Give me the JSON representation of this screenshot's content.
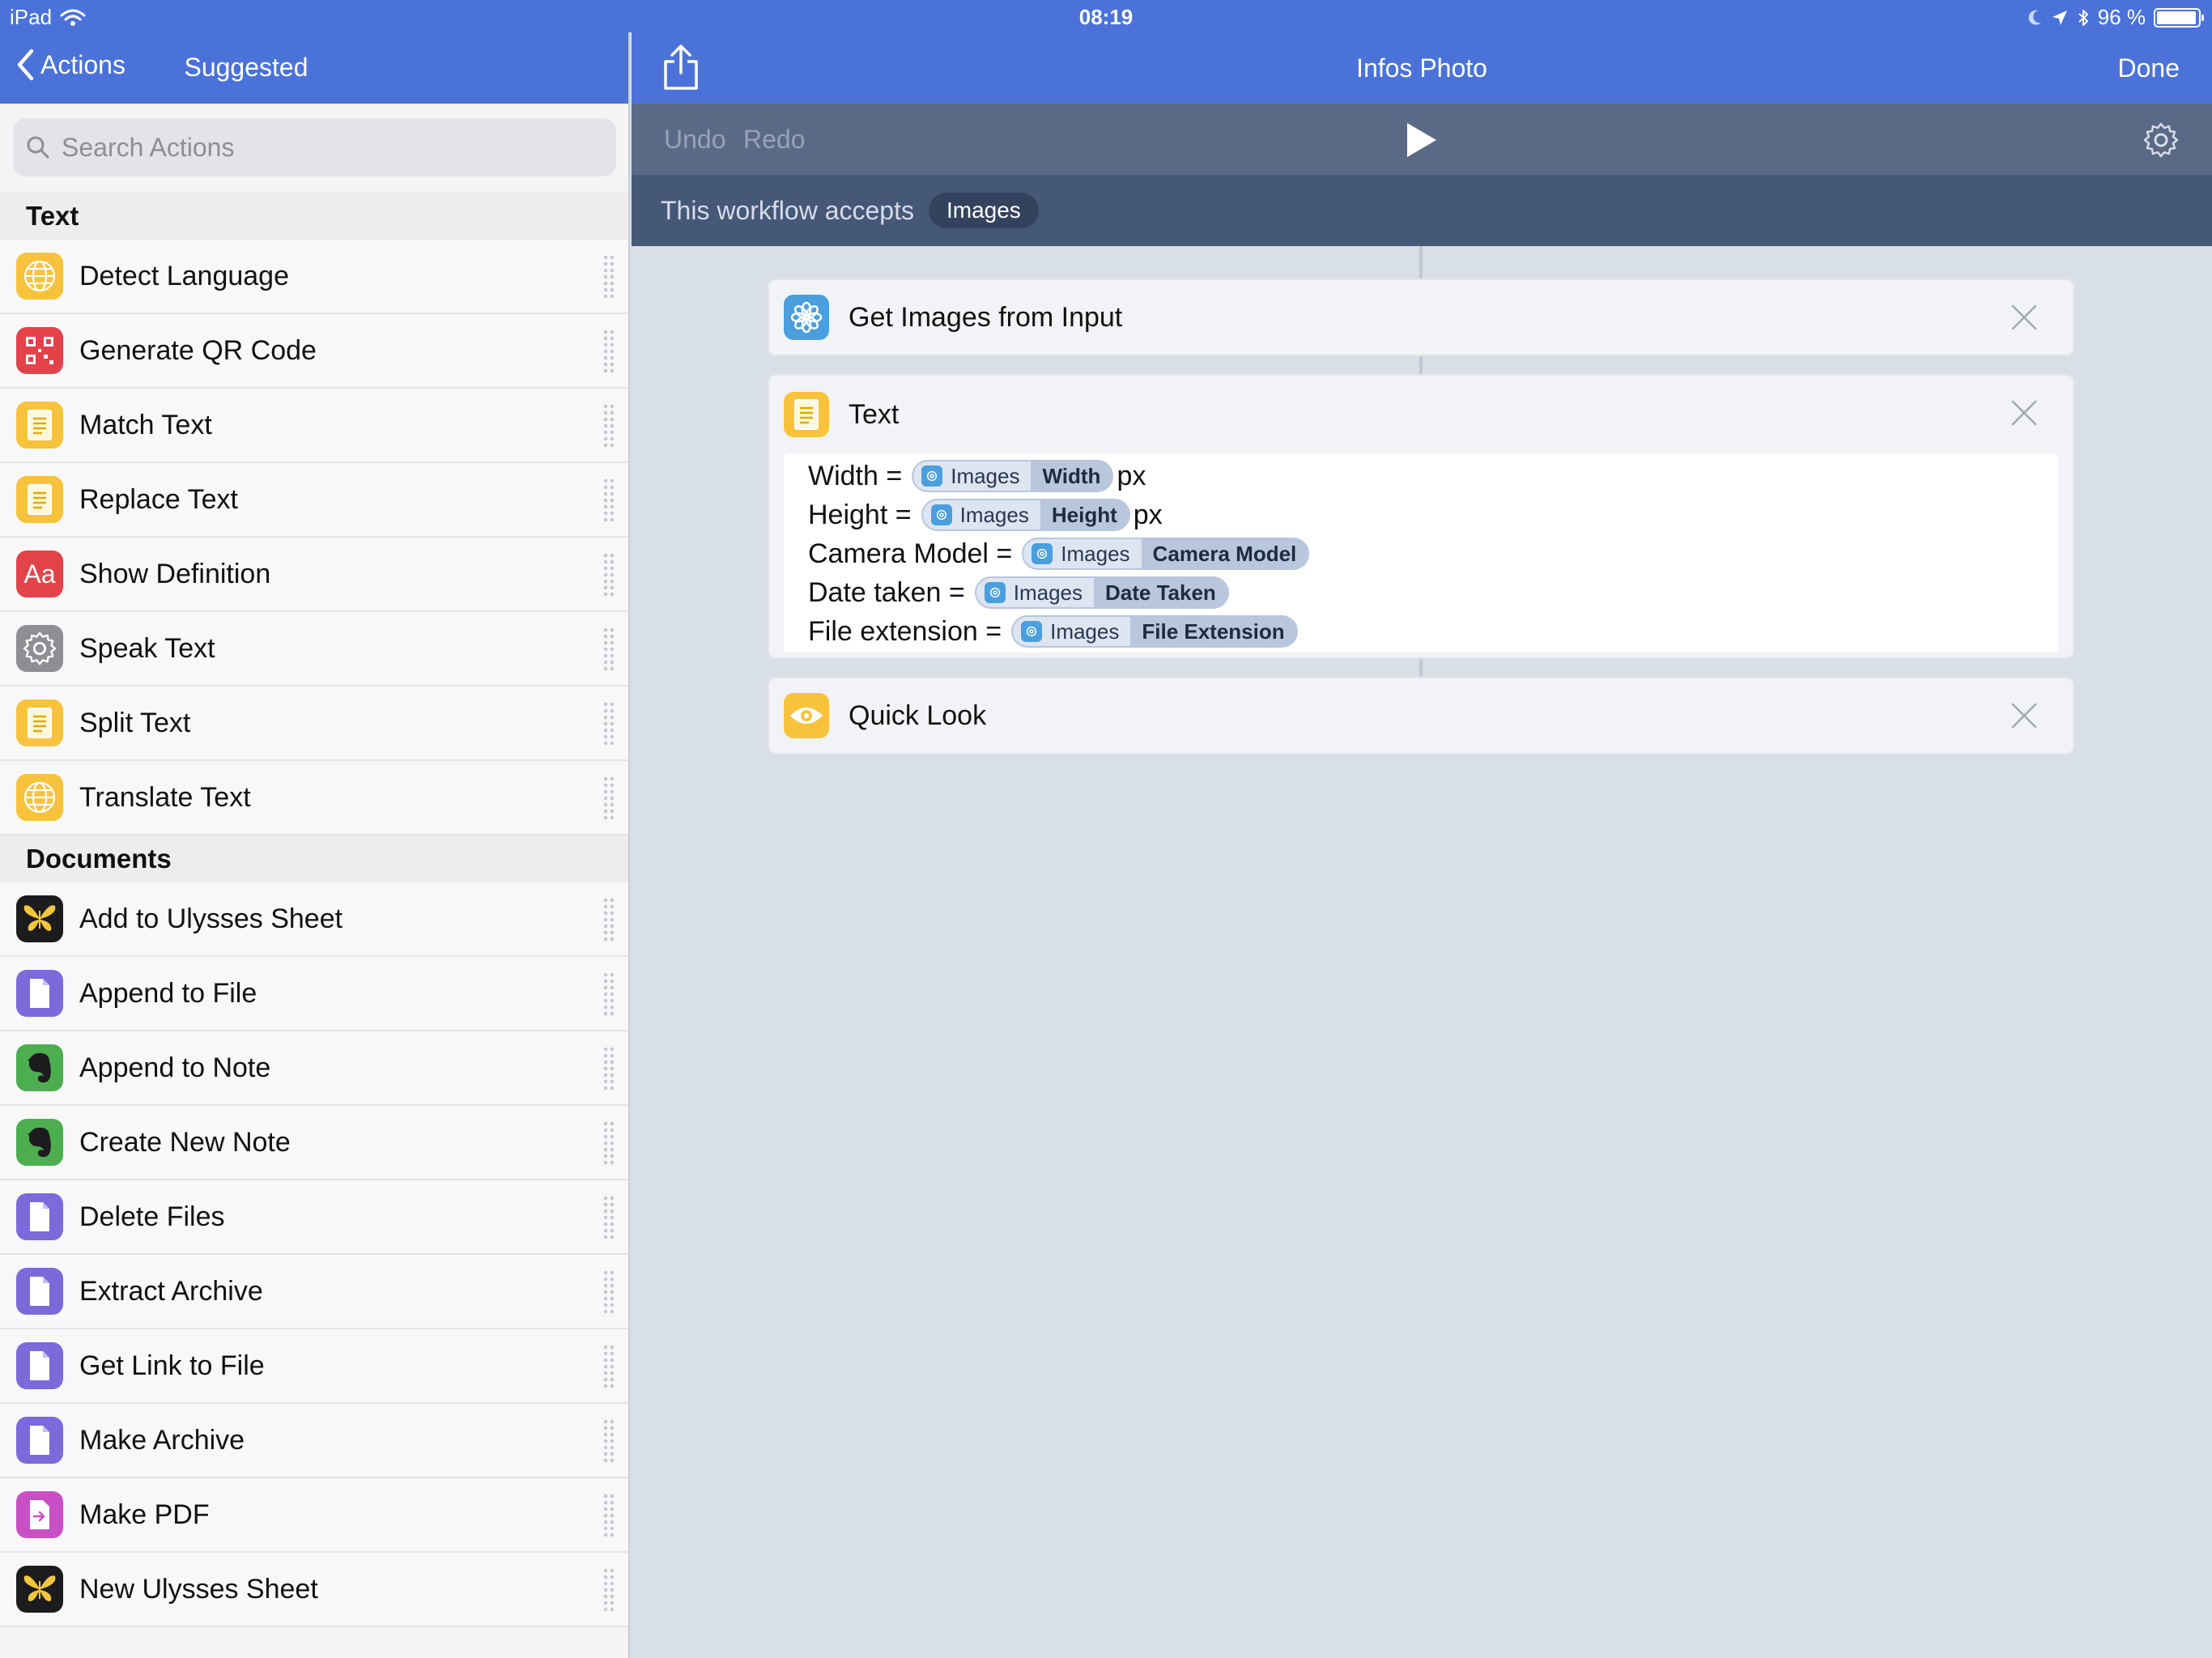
{
  "status": {
    "device": "iPad",
    "time": "08:19",
    "battery_text": "96 %",
    "battery_level": 0.96
  },
  "sidebar": {
    "back_label": "Actions",
    "title": "Suggested",
    "search_placeholder": "Search Actions",
    "sections": [
      {
        "title": "Text",
        "items": [
          {
            "label": "Detect Language",
            "icon": "globe-icon",
            "color": "#f7c33c"
          },
          {
            "label": "Generate QR Code",
            "icon": "qr-code-icon",
            "color": "#e3424a"
          },
          {
            "label": "Match Text",
            "icon": "text-doc-icon",
            "color": "#f7c33c"
          },
          {
            "label": "Replace Text",
            "icon": "text-doc-icon",
            "color": "#f7c33c"
          },
          {
            "label": "Show Definition",
            "icon": "dictionary-icon",
            "color": "#e3424a"
          },
          {
            "label": "Speak Text",
            "icon": "gear-icon",
            "color": "#8e8e93"
          },
          {
            "label": "Split Text",
            "icon": "text-doc-icon",
            "color": "#f7c33c"
          },
          {
            "label": "Translate Text",
            "icon": "globe-icon",
            "color": "#f7c33c"
          }
        ]
      },
      {
        "title": "Documents",
        "items": [
          {
            "label": "Add to Ulysses Sheet",
            "icon": "butterfly-icon",
            "color": "#1c1c1e"
          },
          {
            "label": "Append to File",
            "icon": "file-icon",
            "color": "#7b6ad9"
          },
          {
            "label": "Append to Note",
            "icon": "evernote-icon",
            "color": "#4cae4f"
          },
          {
            "label": "Create New Note",
            "icon": "evernote-icon",
            "color": "#4cae4f"
          },
          {
            "label": "Delete Files",
            "icon": "file-icon",
            "color": "#7b6ad9"
          },
          {
            "label": "Extract Archive",
            "icon": "file-icon",
            "color": "#7b6ad9"
          },
          {
            "label": "Get Link to File",
            "icon": "file-icon",
            "color": "#7b6ad9"
          },
          {
            "label": "Make Archive",
            "icon": "file-icon",
            "color": "#7b6ad9"
          },
          {
            "label": "Make PDF",
            "icon": "pdf-icon",
            "color": "#c94fc4"
          },
          {
            "label": "New Ulysses Sheet",
            "icon": "butterfly-icon",
            "color": "#1c1c1e"
          }
        ]
      }
    ]
  },
  "main": {
    "title": "Infos Photo",
    "done_label": "Done",
    "undo_label": "Undo",
    "redo_label": "Redo",
    "accepts_label": "This workflow accepts",
    "accepts_type": "Images",
    "actions": [
      {
        "title": "Get Images from Input",
        "icon": "flower-icon",
        "color": "#4a9fdc"
      },
      {
        "title": "Text",
        "icon": "text-doc-icon",
        "color": "#f7c33c"
      },
      {
        "title": "Quick Look",
        "icon": "eye-icon",
        "color": "#f7c33c"
      }
    ],
    "text_lines": [
      {
        "key": "Width =",
        "source": "Images",
        "property": "Width",
        "suffix": "px"
      },
      {
        "key": "Height =",
        "source": "Images",
        "property": "Height",
        "suffix": "px"
      },
      {
        "key": "Camera Model =",
        "source": "Images",
        "property": "Camera Model",
        "suffix": ""
      },
      {
        "key": "Date taken =",
        "source": "Images",
        "property": "Date Taken",
        "suffix": ""
      },
      {
        "key": "File extension =",
        "source": "Images",
        "property": "File Extension",
        "suffix": ""
      }
    ]
  },
  "colors": {
    "nav_blue": "#4a72d9",
    "toolbar": "#5a6a86",
    "accepts_bar": "#465878",
    "canvas": "#d9dfe6"
  }
}
